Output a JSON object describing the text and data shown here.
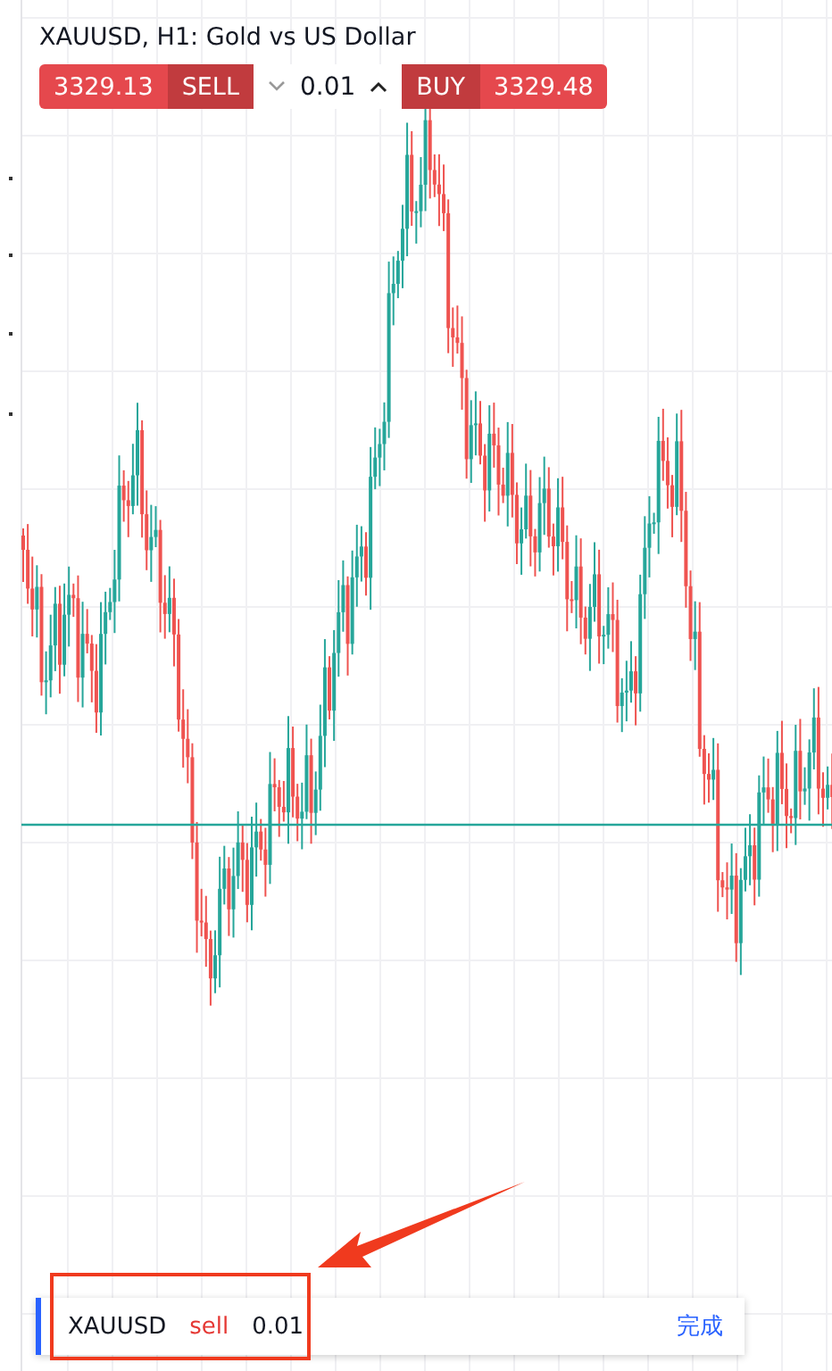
{
  "chart": {
    "title": "XAUUSD, H1: Gold vs US Dollar"
  },
  "trade_panel": {
    "sell_price": "3329.13",
    "sell_label": "SELL",
    "quantity": "0.01",
    "buy_label": "BUY",
    "buy_price": "3329.48"
  },
  "order_bar": {
    "symbol": "XAUUSD",
    "side": "sell",
    "quantity": "0.01",
    "done_label": "完成"
  }
}
